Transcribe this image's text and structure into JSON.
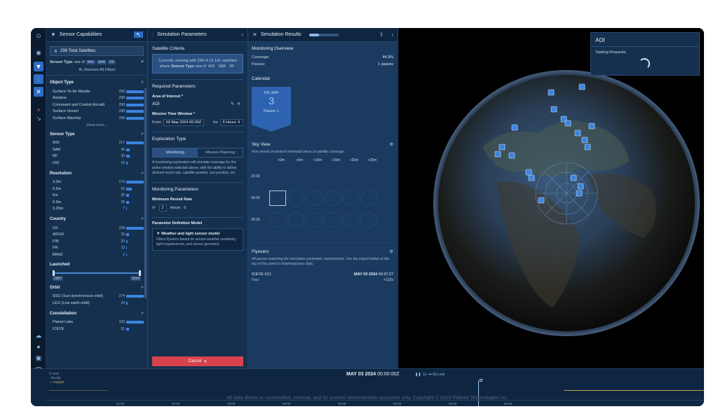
{
  "sensor_panel": {
    "title": "Sensor Capabilities",
    "total_satellites": "298 Total Satellites",
    "sensor_type_label": "Sensor Type",
    "sensor_type_text": "one of",
    "sensor_type_chips": [
      "MSI",
      "SAR",
      "RF"
    ],
    "remove_filters": "Remove All Filters",
    "sections": [
      {
        "title": "Object Type",
        "rows": [
          {
            "label": "Surface-To-Air Missile",
            "count": "298",
            "fraction": 1.0
          },
          {
            "label": "Airplane",
            "count": "298",
            "fraction": 1.0
          },
          {
            "label": "Command and Control Aircraft",
            "count": "298",
            "fraction": 1.0
          },
          {
            "label": "Surface Vessel",
            "count": "298",
            "fraction": 1.0
          },
          {
            "label": "Surface Warship",
            "count": "298",
            "fraction": 1.0
          }
        ],
        "show_more": "Show more..."
      },
      {
        "title": "Sensor Type",
        "rows": [
          {
            "label": "MSI",
            "count": "217",
            "fraction": 1.0
          },
          {
            "label": "SAR",
            "count": "42",
            "fraction": 0.2
          },
          {
            "label": "RF",
            "count": "39",
            "fraction": 0.18
          },
          {
            "label": "HSI",
            "count": "16",
            "fraction": 0.08
          }
        ]
      },
      {
        "title": "Resolution",
        "rows": [
          {
            "label": "3.3m",
            "count": "176",
            "fraction": 1.0
          },
          {
            "label": "0.5m",
            "count": "53",
            "fraction": 0.3
          },
          {
            "label": "5m",
            "count": "25",
            "fraction": 0.15
          },
          {
            "label": "0.9m",
            "count": "25",
            "fraction": 0.15
          },
          {
            "label": "0.25m",
            "count": "7",
            "fraction": 0.04
          }
        ]
      },
      {
        "title": "Country",
        "rows": [
          {
            "label": "US",
            "count": "228",
            "fraction": 1.0
          },
          {
            "label": "ARGN",
            "count": "35",
            "fraction": 0.15
          },
          {
            "label": "FIN",
            "count": "20",
            "fraction": 0.09
          },
          {
            "label": "FR",
            "count": "12",
            "fraction": 0.05
          },
          {
            "label": "BRAZ",
            "count": "2",
            "fraction": 0.01
          }
        ]
      }
    ],
    "launched": {
      "title": "Launched",
      "from": "1957",
      "to": "2024"
    },
    "orbit": {
      "title": "Orbit",
      "rows": [
        {
          "label": "SSO (Sun-synchronous orbit)",
          "count": "274",
          "fraction": 1.0
        },
        {
          "label": "LEO (Low earth orbit)",
          "count": "24",
          "fraction": 0.09
        }
      ]
    },
    "constellation": {
      "title": "Constellation",
      "rows": [
        {
          "label": "Planet Labs",
          "count": "192",
          "fraction": 1.0
        },
        {
          "label": "ICEYE",
          "count": "31",
          "fraction": 0.16
        }
      ]
    }
  },
  "sim_params": {
    "title": "Simulation Parameters",
    "satellite_criteria": "Satellite Criteria",
    "info_line1": "Currently working with 298 of 12,141 satellites",
    "info_line2_prefix": "where",
    "info_line2_bold": "Sensor Type",
    "info_line2_mid": "one of",
    "info_chips": [
      "MSI",
      "SAR",
      "RF"
    ],
    "required": "Required Parameters",
    "aoi_label": "Area of Interest *",
    "aoi_value": "AOI",
    "mtw_label": "Mission Time Window *",
    "from_label": "From",
    "from_value": "03 May 2024 00:00Z",
    "for_label": "for",
    "for_value": "6 Hours",
    "exploration_type": "Exploration Type",
    "seg_monitoring": "Monitoring",
    "seg_planning": "Mission Planning",
    "monitoring_desc": "A monitoring exploration will simulate coverage for the entire window selected above, with the ability to define desired revisit rate, satellite position, sun position, etc.",
    "monitoring_params": "Monitoring Parameters",
    "min_revisit": "Minimum Revisit Rate",
    "revisit_hours_val": "2",
    "revisit_hours_label": "Hours",
    "revisit_min_val": "0",
    "param_model": "Parameter Definition Model",
    "model_title": "Weather and light sensor model",
    "model_desc": "Filters flyovers based on sensor-weather sensitivity, light requirements, and sensor geometry.",
    "cancel": "Cancel"
  },
  "results": {
    "title": "Simulation Results",
    "progress": 0.33,
    "overview_title": "Monitoring Overview",
    "coverage_label": "Coverage:",
    "coverage_value": "44.3%",
    "passes_label": "Passes:",
    "passes_value": "1 passes",
    "calendar_title": "Calendar",
    "cal_month": "FRI, MAY",
    "cal_day": "3",
    "cal_passes": "Passes: 1",
    "sky_title": "Sky View",
    "sky_desc": "Five minute increment overhead views of satellite coverage.",
    "sky_cols": [
      "+0m",
      "+5m",
      "+10m",
      "+15m",
      "+20m",
      "+25m"
    ],
    "sky_rows": [
      "23:30",
      "00:00",
      "00:30"
    ],
    "flyovers_title": "Flyovers",
    "flyovers_desc": "All passes matching the simulation parameter requirements. Use the export button at the top of this panel to download pass data.",
    "fly_name": "ICEYE-X11",
    "fly_date": "MAY 03 2024",
    "fly_time": "00:37:27",
    "fly_sub": "Paar",
    "fly_dur": "<122s"
  },
  "aoi_panel": {
    "title": "AOI",
    "tasking": "Tasking Requests"
  },
  "timeline": {
    "legend": [
      "SAR",
      "Revisit",
      "Daylight"
    ],
    "now_date": "MAY 03 2024",
    "now_time": "00:00:00Z",
    "speed": "1x",
    "go_live": "Go Live",
    "ticks": [
      "21:00",
      "22:00",
      "23:00",
      "00:00",
      "01:00",
      "02:00",
      "03:00",
      "04:00"
    ],
    "disclaimer": "All data shown is unclassified, notional, and for product demonstration purposes only. Copyright © 2024 Palantir Technologies Inc."
  },
  "colors": {
    "accent": "#3b84e0",
    "danger": "#d8424f",
    "panel": "#15304f"
  }
}
